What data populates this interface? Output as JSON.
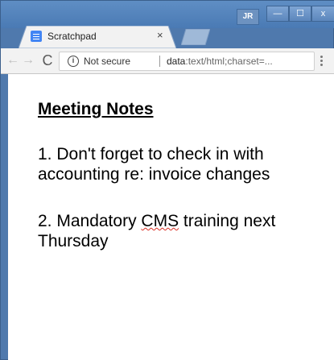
{
  "browser": {
    "tab": {
      "title": "Scratchpad",
      "close_glyph": "×",
      "favicon": "document-icon"
    },
    "profile_badge": "JR",
    "window_controls": {
      "minimize": "—",
      "maximize": "☐",
      "close": "x"
    },
    "nav": {
      "back": "←",
      "forward": "→",
      "reload": "C"
    },
    "omnibox": {
      "security_label": "Not secure",
      "url_host": "data",
      "url_rest": ":text/html;charset=..."
    }
  },
  "note": {
    "heading": "Meeting Notes",
    "item1": "1. Don't forget to check in with accounting re: invoice changes",
    "item2_before": "2. Mandatory ",
    "item2_flagged": "CMS",
    "item2_after": " training next Thursday"
  },
  "colors": {
    "window_frame": "#4f79ad",
    "toolbar": "#f2f2f2",
    "spellcheck_underline": "#d93025",
    "favicon": "#4285f4"
  }
}
